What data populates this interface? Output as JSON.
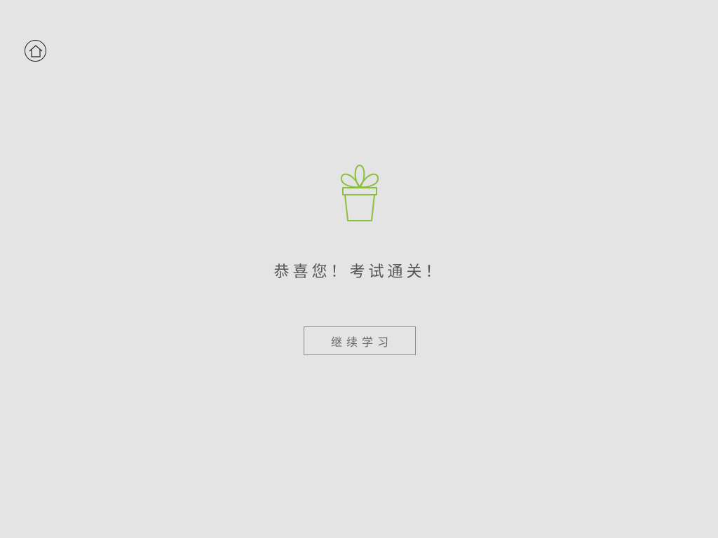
{
  "header": {
    "home_icon": "home-icon"
  },
  "main": {
    "illustration_icon": "potted-plant-icon",
    "message": "恭喜您！考试通关！",
    "continue_label": "继续学习"
  },
  "colors": {
    "background": "#e4e4e4",
    "accent": "#8cbf3f",
    "text": "#555555",
    "button_border": "#8a8a8a"
  }
}
